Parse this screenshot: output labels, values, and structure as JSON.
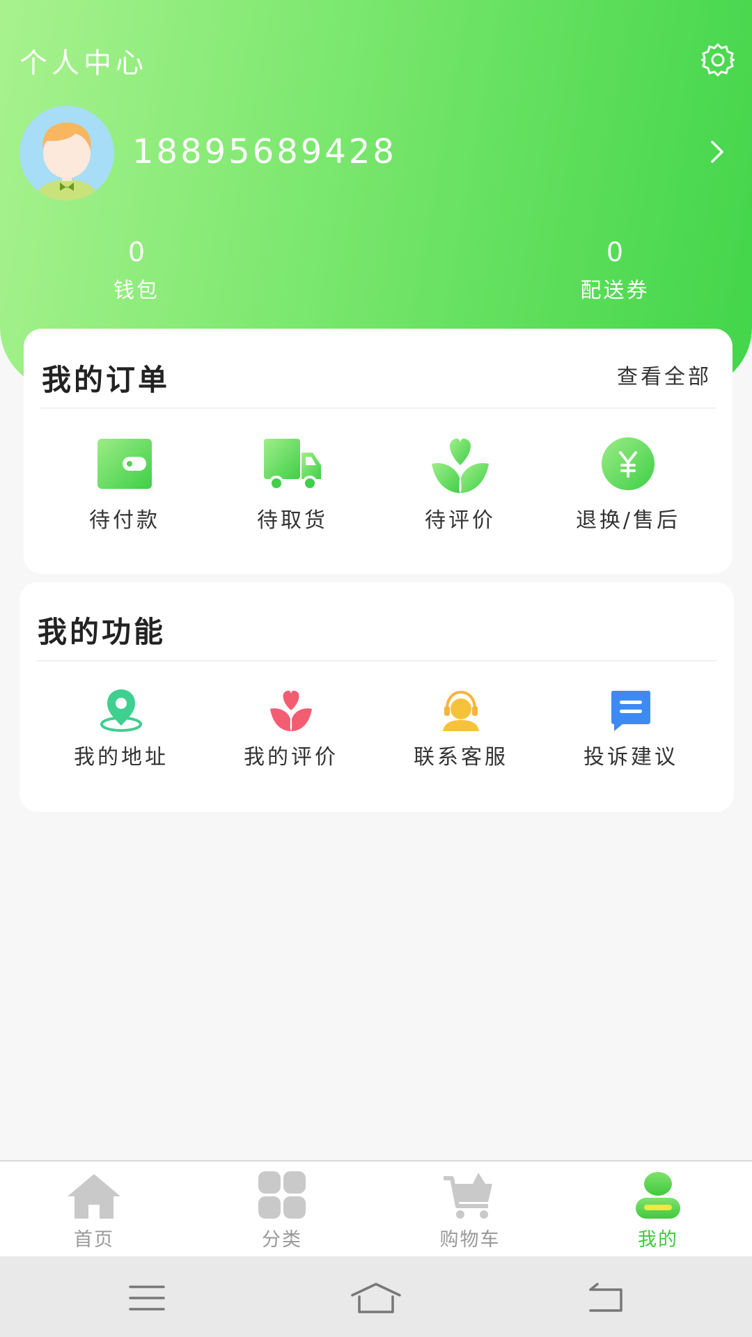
{
  "header": {
    "title": "个人中心",
    "phone": "18895689428",
    "stats": [
      {
        "value": "0",
        "label": "钱包"
      },
      {
        "value": "0",
        "label": "配送券"
      }
    ]
  },
  "orders": {
    "title": "我的订单",
    "view_all": "查看全部",
    "items": [
      {
        "label": "待付款",
        "icon": "wallet-icon"
      },
      {
        "label": "待取货",
        "icon": "truck-icon"
      },
      {
        "label": "待评价",
        "icon": "heart-sprout-icon"
      },
      {
        "label": "退换/售后",
        "icon": "yen-coin-icon"
      }
    ]
  },
  "functions": {
    "title": "我的功能",
    "items": [
      {
        "label": "我的地址",
        "icon": "location-pin-icon"
      },
      {
        "label": "我的评价",
        "icon": "heart-sprout-icon"
      },
      {
        "label": "联系客服",
        "icon": "customer-service-icon"
      },
      {
        "label": "投诉建议",
        "icon": "chat-bubble-icon"
      }
    ]
  },
  "tabbar": {
    "items": [
      {
        "label": "首页",
        "icon": "home-icon"
      },
      {
        "label": "分类",
        "icon": "category-grid-icon"
      },
      {
        "label": "购物车",
        "icon": "cart-icon"
      },
      {
        "label": "我的",
        "icon": "user-icon",
        "active": true
      }
    ]
  },
  "colors": {
    "brand_green": "#42d54a",
    "brand_light": "#a8f28e",
    "active_tab": "#40c93e",
    "inactive_tab": "#999999"
  }
}
